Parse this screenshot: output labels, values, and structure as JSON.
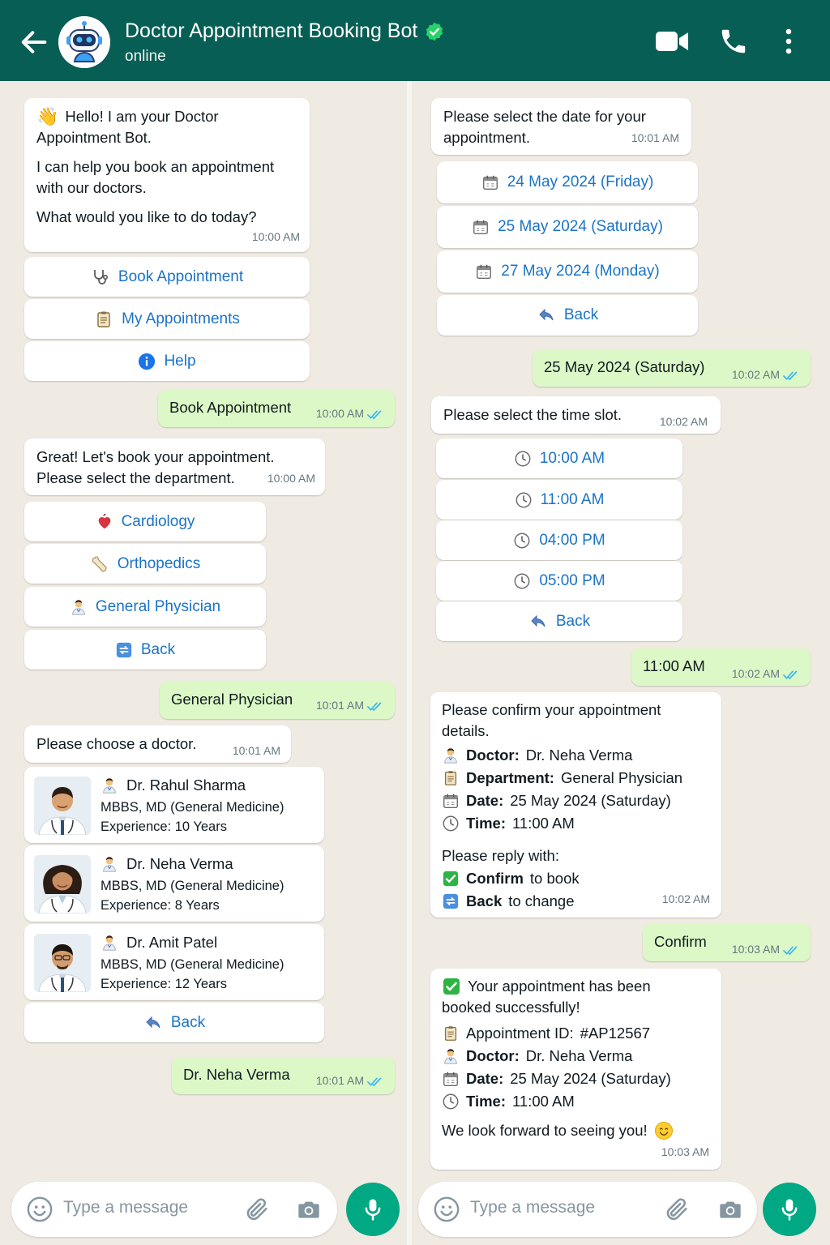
{
  "header": {
    "title": "Doctor Appointment Booking Bot",
    "status": "online",
    "icons": [
      "back-arrow-icon",
      "bot-avatar-icon",
      "verified-badge-icon",
      "video-call-icon",
      "phone-icon",
      "more-menu-icon"
    ]
  },
  "colors": {
    "header": "#075e54",
    "outgoing": "#dcf8c6",
    "link": "#1a73c9",
    "mic": "#00a884",
    "tick": "#34b7f1"
  },
  "left": {
    "welcome": {
      "line1": "Hello! I am your Doctor",
      "line2": "Appointment Bot.",
      "line3": "I can help you book an appointment",
      "line4": "with our doctors.",
      "line5": "What would you like to do today?",
      "time": "10:00 AM"
    },
    "menu": {
      "book": "Book Appointment",
      "my": "My Appointments",
      "help": "Help"
    },
    "reply1": {
      "text": "Book Appointment",
      "time": "10:00 AM"
    },
    "dept_msg": {
      "line1": "Great! Let's book your appointment.",
      "line2": "Please select the department.",
      "time": "10:00 AM"
    },
    "depts": {
      "cardiology": "Cardiology",
      "ortho": "Orthopedics",
      "gp": "General Physician",
      "back": "Back"
    },
    "reply2": {
      "text": "General Physician",
      "time": "10:01 AM"
    },
    "choose": {
      "text": "Please choose a doctor.",
      "time": "10:01 AM"
    },
    "doctors": [
      {
        "name": "Dr. Rahul Sharma",
        "degree": "MBBS, MD (General Medicine)",
        "exp": "Experience: 10 Years"
      },
      {
        "name": "Dr. Neha Verma",
        "degree": "MBBS, MD (General Medicine)",
        "exp": "Experience: 8 Years"
      },
      {
        "name": "Dr. Amit Patel",
        "degree": "MBBS, MD (General Medicine)",
        "exp": "Experience: 12 Years"
      }
    ],
    "doc_back": "Back",
    "reply3": {
      "text": "Dr. Neha Verma",
      "time": "10:01 AM"
    },
    "input": {
      "placeholder": "Type a message"
    }
  },
  "right": {
    "date_msg": {
      "line1": "Please select the date for your",
      "line2": "appointment.",
      "time": "10:01 AM"
    },
    "dates": [
      "24 May 2024 (Friday)",
      "25 May 2024 (Saturday)",
      "27 May 2024 (Monday)"
    ],
    "date_back": "Back",
    "reply4": {
      "text": "25 May 2024 (Saturday)",
      "time": "10:02 AM"
    },
    "time_msg": {
      "text": "Please select the time slot.",
      "time": "10:02 AM"
    },
    "slots": [
      "10:00 AM",
      "11:00 AM",
      "04:00 PM",
      "05:00 PM"
    ],
    "slot_back": "Back",
    "reply5": {
      "text": "11:00 AM",
      "time": "10:02 AM"
    },
    "confirm_msg": {
      "line1": "Please confirm your appointment",
      "line2": "details.",
      "doctor_label": "Doctor:",
      "doctor": "Dr. Neha Verma",
      "dept_label": "Department:",
      "dept": "General Physician",
      "date_label": "Date:",
      "date": "25 May 2024 (Saturday)",
      "time_label": "Time:",
      "time_val": "11:00 AM",
      "reply_with": "Please reply with:",
      "confirm_word": "Confirm",
      "confirm_rest": "to book",
      "back_word": "Back",
      "back_rest": "to change",
      "time": "10:02 AM"
    },
    "reply6": {
      "text": "Confirm",
      "time": "10:03 AM"
    },
    "success_msg": {
      "line1": "Your appointment has been",
      "line2": "booked successfully!",
      "id_label": "Appointment ID:",
      "id": "#AP12567",
      "doctor_label": "Doctor:",
      "doctor": "Dr. Neha Verma",
      "date_label": "Date:",
      "date": "25 May 2024 (Saturday)",
      "time_label": "Time:",
      "time_val": "11:00 AM",
      "closing": "We look forward to seeing you!",
      "time": "10:03 AM"
    },
    "input": {
      "placeholder": "Type a message"
    }
  }
}
